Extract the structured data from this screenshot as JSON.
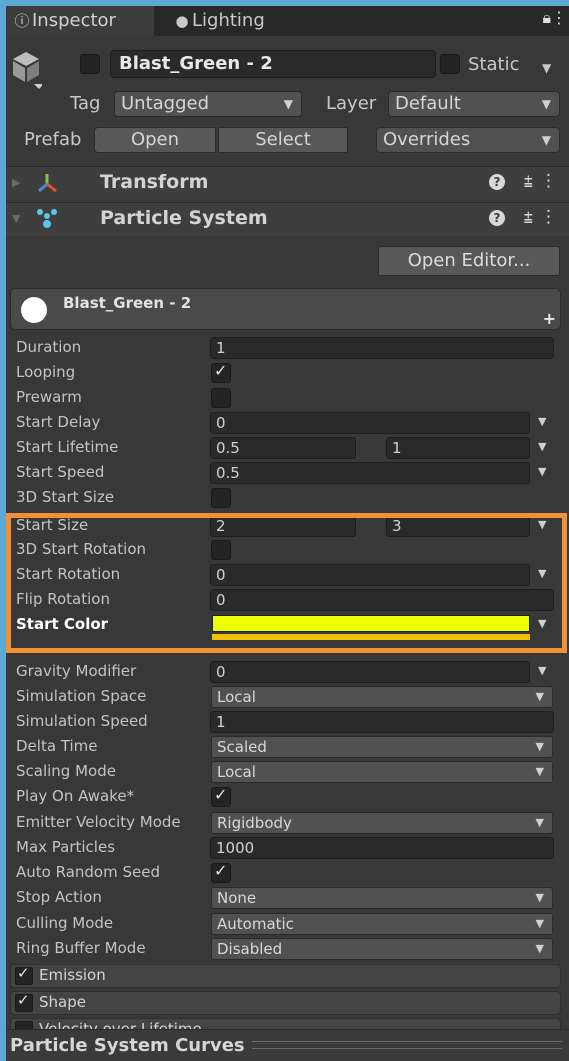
{
  "tabs": [
    {
      "label": "Inspector",
      "icon": "info-icon"
    },
    {
      "label": "Lighting",
      "icon": "lightbulb-icon"
    }
  ],
  "header": {
    "active": false,
    "name": "Blast_Green - 2",
    "static_label": "Static",
    "static_checked": false,
    "tag_label": "Tag",
    "tag_value": "Untagged",
    "layer_label": "Layer",
    "layer_value": "Default",
    "prefab_label": "Prefab",
    "prefab_open": "Open",
    "prefab_select": "Select",
    "prefab_overrides": "Overrides"
  },
  "components": {
    "transform": {
      "title": "Transform",
      "icon": "transform-icon"
    },
    "particle_system": {
      "title": "Particle System",
      "icon": "particle-system-icon"
    }
  },
  "open_editor_label": "Open Editor...",
  "system_name": "Blast_Green - 2",
  "properties": {
    "duration": {
      "label": "Duration",
      "value": "1"
    },
    "looping": {
      "label": "Looping",
      "checked": true
    },
    "prewarm": {
      "label": "Prewarm",
      "checked": false
    },
    "start_delay": {
      "label": "Start Delay",
      "value": "0"
    },
    "start_lifetime": {
      "label": "Start Lifetime",
      "min": "0.5",
      "max": "1"
    },
    "start_speed": {
      "label": "Start Speed",
      "value": "0.5"
    },
    "start_size_3d": {
      "label": "3D Start Size",
      "checked": false
    },
    "start_size": {
      "label": "Start Size",
      "min": "2",
      "max": "3"
    },
    "start_rotation_3d": {
      "label": "3D Start Rotation",
      "checked": false
    },
    "start_rotation": {
      "label": "Start Rotation",
      "value": "0"
    },
    "flip_rotation": {
      "label": "Flip Rotation",
      "value": "0"
    },
    "start_color": {
      "label": "Start Color",
      "color_min": "#ecff00",
      "color_max": "#f0c000"
    },
    "gravity_modifier": {
      "label": "Gravity Modifier",
      "value": "0"
    },
    "simulation_space": {
      "label": "Simulation Space",
      "value": "Local"
    },
    "simulation_speed": {
      "label": "Simulation Speed",
      "value": "1"
    },
    "delta_time": {
      "label": "Delta Time",
      "value": "Scaled"
    },
    "scaling_mode": {
      "label": "Scaling Mode",
      "value": "Local"
    },
    "play_on_awake": {
      "label": "Play On Awake*",
      "checked": true
    },
    "emitter_velocity_mode": {
      "label": "Emitter Velocity Mode",
      "value": "Rigidbody"
    },
    "max_particles": {
      "label": "Max Particles",
      "value": "1000"
    },
    "auto_random_seed": {
      "label": "Auto Random Seed",
      "checked": true
    },
    "stop_action": {
      "label": "Stop Action",
      "value": "None"
    },
    "culling_mode": {
      "label": "Culling Mode",
      "value": "Automatic"
    },
    "ring_buffer_mode": {
      "label": "Ring Buffer Mode",
      "value": "Disabled"
    }
  },
  "modules": [
    {
      "label": "Emission",
      "enabled": true
    },
    {
      "label": "Shape",
      "enabled": true
    },
    {
      "label": "Velocity over Lifetime",
      "enabled": false
    }
  ],
  "curves_label": "Particle System Curves",
  "colors": {
    "highlight": "#f0913a",
    "panel": "#383838",
    "background": "#5ea9d3"
  }
}
